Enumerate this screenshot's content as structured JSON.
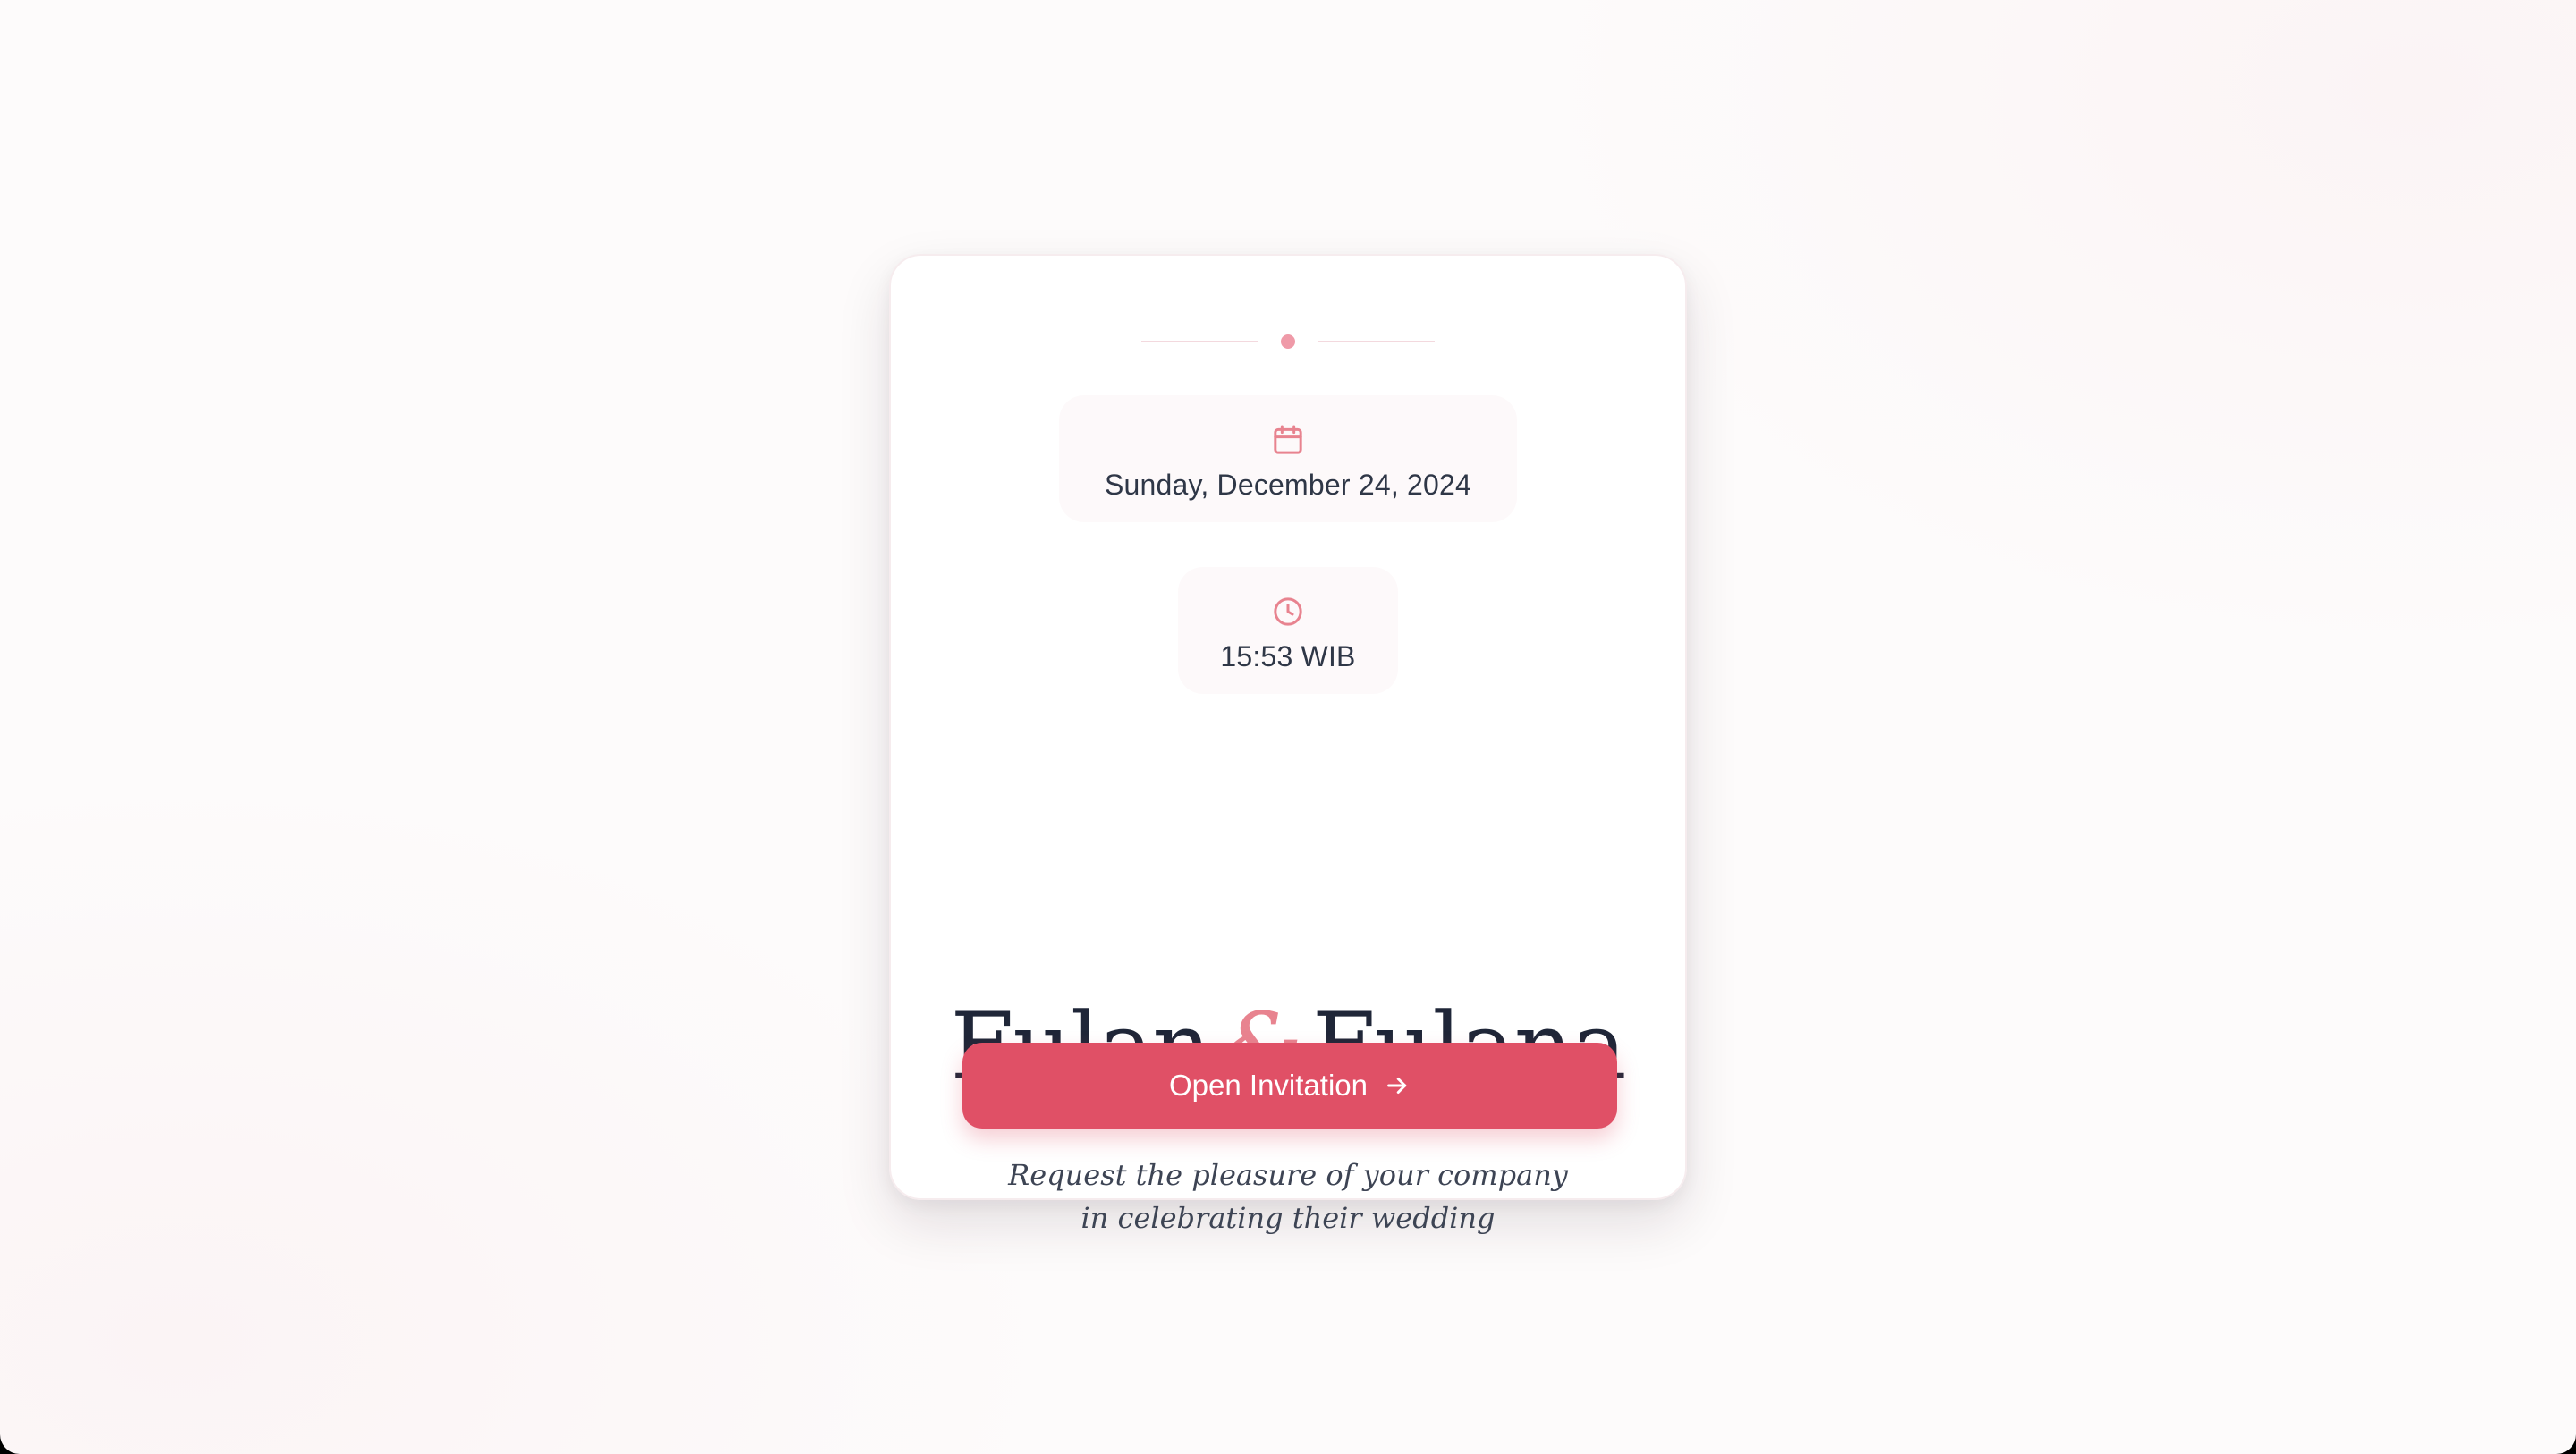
{
  "invitation": {
    "date": "Sunday, December 24, 2024",
    "time": "15:53 WIB",
    "bride_groom_first": "Fulan",
    "ampersand": "&",
    "bride_groom_second": "Fulana",
    "tagline_line1": "Request the pleasure of your company",
    "tagline_line2": "in celebrating their wedding",
    "open_button_label": "Open Invitation"
  },
  "icons": {
    "date_icon": "calendar-icon",
    "time_icon": "clock-icon",
    "button_icon": "arrow-right-icon"
  },
  "colors": {
    "accent": "#e05066",
    "accent_soft": "#e8838f",
    "text_dark": "#1f2638",
    "text_body": "#2f3747"
  }
}
